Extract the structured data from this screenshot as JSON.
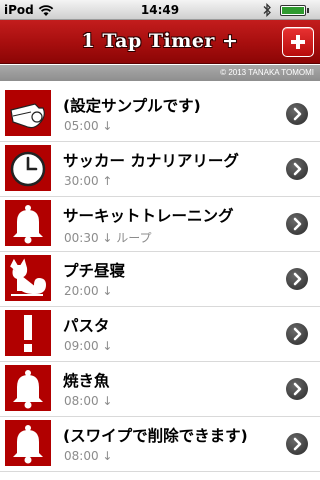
{
  "status_bar": {
    "carrier": "iPod",
    "time": "14:49"
  },
  "nav": {
    "title": "1 Tap Timer +",
    "add_button_label": "+"
  },
  "copyright": "© 2013 TANAKA TOMOMI",
  "timers": [
    {
      "title": "(設定サンプルです)",
      "subtitle": "05:00 ↓",
      "icon": "whistle-icon"
    },
    {
      "title": "サッカー カナリアリーグ",
      "subtitle": "30:00 ↑",
      "icon": "clock-icon"
    },
    {
      "title": "サーキットトレーニング",
      "subtitle": "00:30 ↓ ループ",
      "icon": "bell-icon"
    },
    {
      "title": "プチ昼寝",
      "subtitle": "20:00 ↓",
      "icon": "cat-icon"
    },
    {
      "title": "パスタ",
      "subtitle": "09:00 ↓",
      "icon": "exclamation-icon"
    },
    {
      "title": "焼き魚",
      "subtitle": "08:00 ↓",
      "icon": "bell-icon"
    },
    {
      "title": "(スワイプで削除できます)",
      "subtitle": "08:00 ↓",
      "icon": "bell-icon"
    }
  ],
  "colors": {
    "brand_red": "#b10000",
    "nav_red": "#a90f0f",
    "subtitle_gray": "#8c8c8c"
  }
}
